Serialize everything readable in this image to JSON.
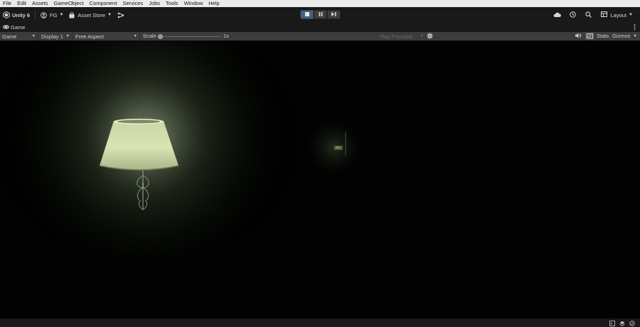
{
  "menu": [
    "File",
    "Edit",
    "Assets",
    "GameObject",
    "Component",
    "Services",
    "Jobs",
    "Tools",
    "Window",
    "Help"
  ],
  "toolbar": {
    "app_title": "Unity 6",
    "account_label": "FG",
    "asset_store_label": "Asset Store",
    "layout_label": "Layout",
    "play_state": "playing"
  },
  "tab": {
    "label": "Game"
  },
  "game_toolbar": {
    "view_label": "Game",
    "display_label": "Display 1",
    "aspect_label": "Free Aspect",
    "scale_label": "Scale",
    "scale_value": "1x",
    "play_mode_label": "Play Focused",
    "stats_label": "Stats",
    "gizmos_label": "Gizmos"
  },
  "colors": {
    "menubar_bg": "#ebebeb",
    "toolbar_bg": "#191919",
    "game_toolbar_bg": "#3c3c3c",
    "play_active": "#46607c",
    "scene_light": "#c9d9a8"
  },
  "icons": [
    "unity-logo-icon",
    "account-icon",
    "asset-store-icon",
    "version-control-icon",
    "stop-icon",
    "pause-icon",
    "step-icon",
    "cloud-icon",
    "history-icon",
    "search-icon",
    "layout-icon",
    "game-tab-icon",
    "more-menu-icon",
    "settings-gear-icon",
    "mute-audio-icon",
    "aspect-icon",
    "console-icon",
    "notifications-icon",
    "activity-icon"
  ]
}
